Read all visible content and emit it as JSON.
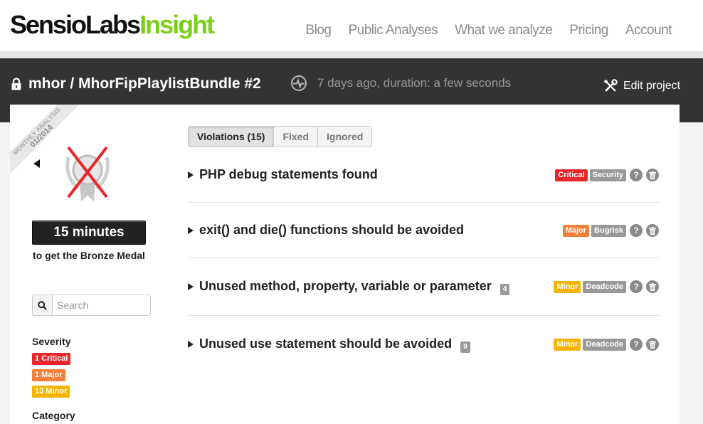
{
  "brand": {
    "name_part1": "SensioLabs",
    "name_part2": "Insight",
    "accent": "#7ccf17"
  },
  "nav": [
    "Blog",
    "Public Analyses",
    "What we analyze",
    "Pricing",
    "Account"
  ],
  "project": {
    "title": "mhor / MhorFipPlaylistBundle #2",
    "status": "7 days ago, duration: a few seconds",
    "edit_label": "Edit project"
  },
  "sidebar": {
    "ribbon_line1": "MONTHLY ANALYSIS",
    "ribbon_line2": "01/2014",
    "time": "15 minutes",
    "time_caption": "to get the Bronze Medal",
    "search_placeholder": "Search",
    "severity_heading": "Severity",
    "severity_tags": [
      {
        "label": "1 Critical",
        "color": "#e8252b"
      },
      {
        "label": "1 Major",
        "color": "#f47f3a"
      },
      {
        "label": "13 Minor",
        "color": "#f5b400"
      }
    ],
    "category_heading": "Category"
  },
  "tabs": [
    "Violations (15)",
    "Fixed",
    "Ignored"
  ],
  "violations": [
    {
      "title": "PHP debug statements found",
      "count": "",
      "severity": "Critical",
      "severity_color": "#e8252b",
      "category": "Security"
    },
    {
      "title": "exit() and die() functions should be avoided",
      "count": "",
      "severity": "Major",
      "severity_color": "#f47f3a",
      "category": "Bugrisk"
    },
    {
      "title": "Unused method, property, variable or parameter",
      "count": "4",
      "severity": "Minor",
      "severity_color": "#f5b400",
      "category": "Deadcode"
    },
    {
      "title": "Unused use statement should be avoided",
      "count": "9",
      "severity": "Minor",
      "severity_color": "#f5b400",
      "category": "Deadcode"
    }
  ],
  "help_glyph": "?",
  "icons": [
    "lock-icon",
    "activity-icon",
    "tools-icon",
    "medal-icon",
    "search-icon",
    "help-icon",
    "trash-icon"
  ]
}
